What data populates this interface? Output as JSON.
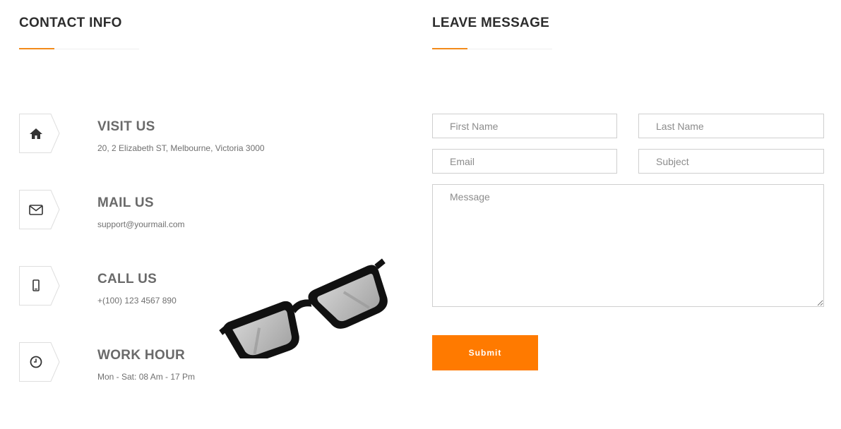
{
  "contact": {
    "title": "CONTACT INFO",
    "items": [
      {
        "title": "VISIT US",
        "text": "20, 2 Elizabeth ST, Melbourne, Victoria 3000",
        "icon": "home-icon"
      },
      {
        "title": "MAIL US",
        "text": "support@yourmail.com",
        "icon": "envelope-icon"
      },
      {
        "title": "CALL US",
        "text": "+(100) 123 4567 890",
        "icon": "mobile-phone-icon"
      },
      {
        "title": "WORK HOUR",
        "text": "Mon - Sat: 08 Am - 17 Pm",
        "icon": "clock-icon"
      }
    ]
  },
  "message": {
    "title": "LEAVE MESSAGE",
    "first_name_placeholder": "First Name",
    "last_name_placeholder": "Last Name",
    "email_placeholder": "Email",
    "subject_placeholder": "Subject",
    "message_placeholder": "Message",
    "submit_label": "Submit"
  },
  "colors": {
    "accent": "#f28a1a",
    "button": "#ff7a00"
  }
}
